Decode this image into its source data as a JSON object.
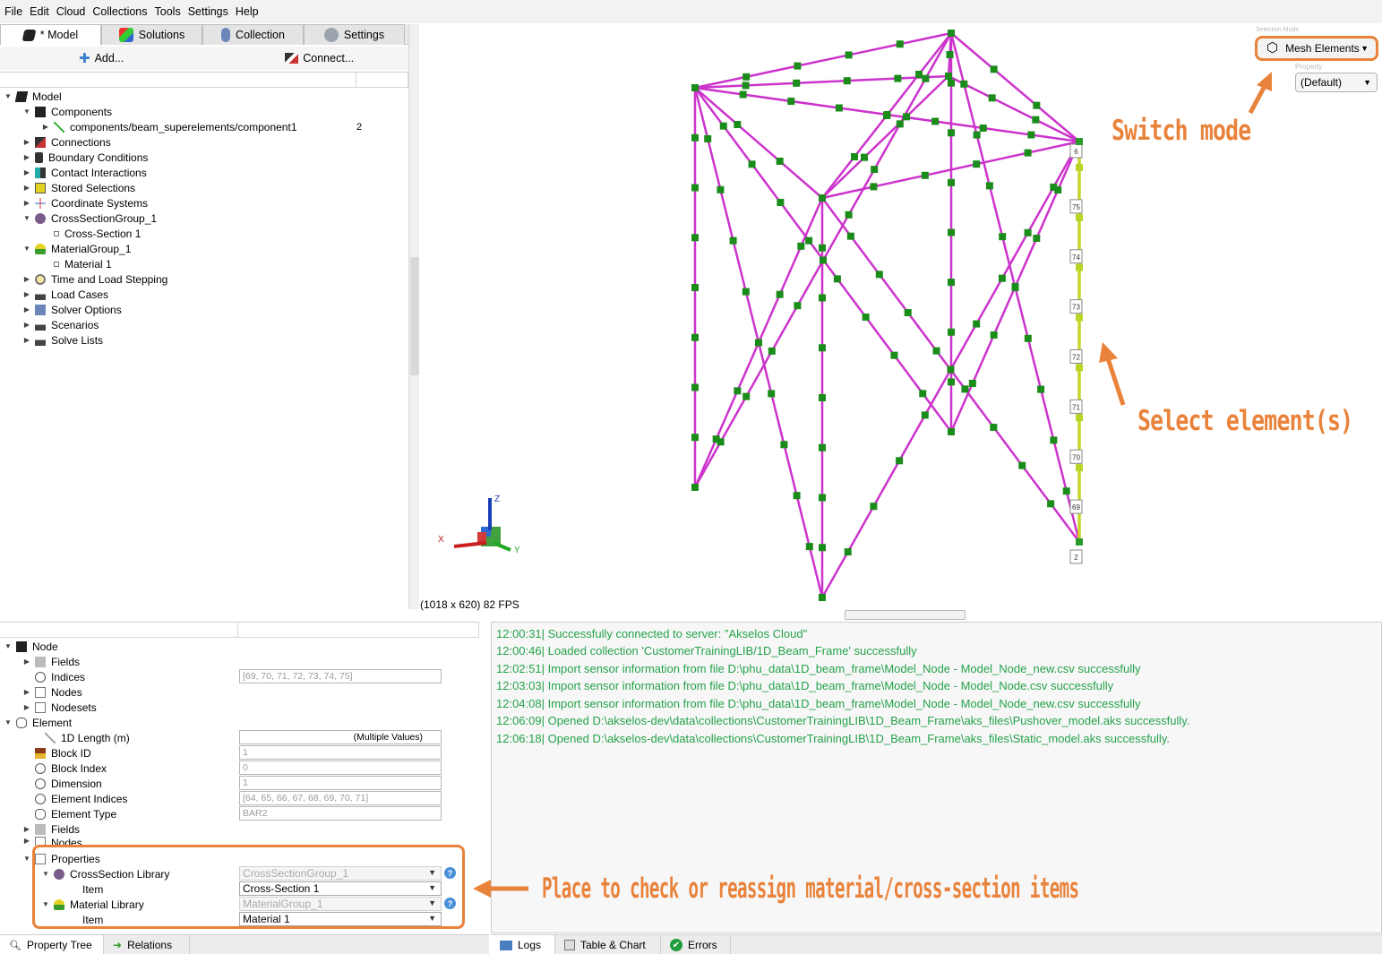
{
  "menu": [
    "File",
    "Edit",
    "Cloud",
    "Collections",
    "Tools",
    "Settings",
    "Help"
  ],
  "tabs": [
    {
      "label": "* Model",
      "icon": "cube-icon",
      "active": true
    },
    {
      "label": "Solutions",
      "icon": "solutions-icon",
      "active": false
    },
    {
      "label": "Collection",
      "icon": "collection-icon",
      "active": false
    },
    {
      "label": "Settings",
      "icon": "gear-icon",
      "active": false
    }
  ],
  "toolbar": {
    "add_label": "Add...",
    "connect_label": "Connect..."
  },
  "tree": {
    "root": "Model",
    "components": "Components",
    "component1": "components/beam_superelements/component1",
    "component1_count": "2",
    "connections": "Connections",
    "boundary_conditions": "Boundary Conditions",
    "contact_interactions": "Contact Interactions",
    "stored_selections": "Stored Selections",
    "coordinate_systems": "Coordinate Systems",
    "cross_section_group": "CrossSectionGroup_1",
    "cross_section_1": "Cross-Section 1",
    "material_group": "MaterialGroup_1",
    "material_1": "Material 1",
    "time_load_stepping": "Time and Load Stepping",
    "load_cases": "Load Cases",
    "solver_options": "Solver Options",
    "scenarios": "Scenarios",
    "solve_lists": "Solve Lists"
  },
  "viewport": {
    "fps_text": "(1018 x 620) 82 FPS",
    "selection_mode_label": "Selection Mode",
    "selection_mode_value": "Mesh Elements",
    "property_label": "Property",
    "property_value": "(Default)",
    "axes": {
      "x": "X",
      "y": "Y",
      "z": "Z"
    },
    "element_labels": [
      "6",
      "75",
      "74",
      "73",
      "72",
      "71",
      "70",
      "69",
      "2"
    ]
  },
  "props": {
    "node": "Node",
    "fields": "Fields",
    "indices": "Indices",
    "indices_value": "[69, 70, 71, 72, 73, 74, 75]",
    "nodes": "Nodes",
    "nodesets": "Nodesets",
    "element": "Element",
    "length_1d": "1D Length (m)",
    "length_1d_value": "(Multiple Values)",
    "block_id": "Block ID",
    "block_id_value": "1",
    "block_index": "Block Index",
    "block_index_value": "0",
    "dimension": "Dimension",
    "dimension_value": "1",
    "element_indices": "Element Indices",
    "element_indices_value": "[64, 65, 66, 67, 68, 69, 70, 71]",
    "element_type": "Element Type",
    "element_type_value": "BAR2",
    "fields2": "Fields",
    "nodes2": "Nodes",
    "properties": "Properties",
    "cs_library": "CrossSection Library",
    "cs_library_value": "CrossSectionGroup_1",
    "cs_item": "Item",
    "cs_item_value": "Cross-Section 1",
    "mat_library": "Material Library",
    "mat_library_value": "MaterialGroup_1",
    "mat_item": "Item",
    "mat_item_value": "Material 1"
  },
  "bottom_tabs_left": [
    "Property Tree",
    "Relations"
  ],
  "bottom_tabs_right": [
    "Logs",
    "Table & Chart",
    "Errors"
  ],
  "logs": [
    "12:00:31| Successfully connected to server: \"Akselos Cloud\"",
    "12:00:46| Loaded collection 'CustomerTrainingLIB/1D_Beam_Frame' successfully",
    "12:02:51| Import sensor information from file D:\\phu_data\\1D_beam_frame\\Model_Node - Model_Node_new.csv successfully",
    "12:03:03| Import sensor information from file D:\\phu_data\\1D_beam_frame\\Model_Node - Model_Node.csv successfully",
    "12:04:08| Import sensor information from file D:\\phu_data\\1D_beam_frame\\Model_Node - Model_Node_new.csv successfully",
    "12:06:09| Opened D:\\akselos-dev\\data\\collections\\CustomerTrainingLIB\\1D_Beam_Frame\\aks_files\\Pushover_model.aks successfully.",
    "12:06:18| Opened D:\\akselos-dev\\data\\collections\\CustomerTrainingLIB\\1D_Beam_Frame\\aks_files\\Static_model.aks successfully."
  ],
  "annotations": {
    "switch_mode": "Switch mode",
    "select_elements": "Select element(s)",
    "place_to_check": "Place to check or reassign material/cross-section items"
  },
  "colors": {
    "accent": "#e9823a",
    "beam": "#cc33cc",
    "node": "#1a8c1a",
    "log_text": "#24a24a",
    "selected": "#c8d42a"
  }
}
